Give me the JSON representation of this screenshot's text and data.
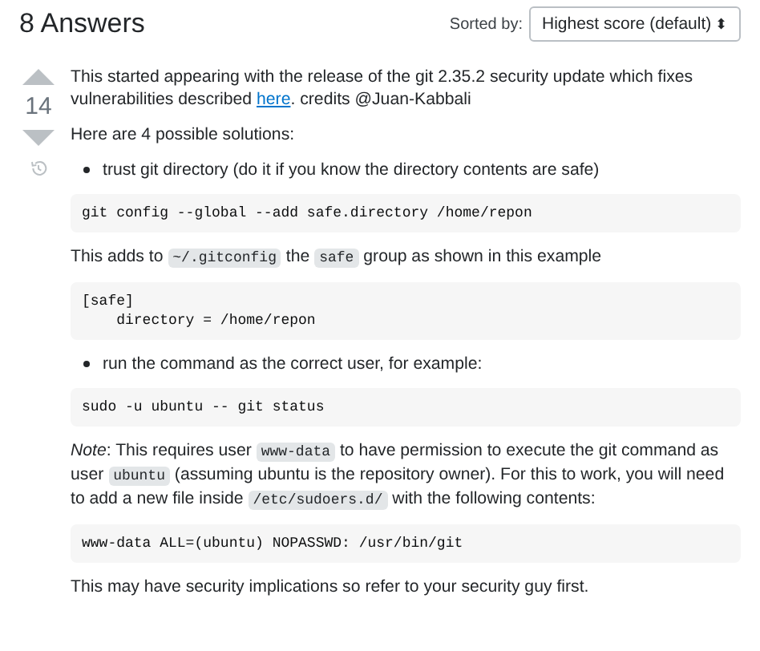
{
  "header": {
    "title": "8 Answers",
    "sort_label": "Sorted by:",
    "sort_value": "Highest score (default)",
    "sort_arrows": "⬍"
  },
  "answer": {
    "score": "14",
    "blocks": [
      {
        "kind": "paragraph",
        "parts": [
          {
            "text": "This started appearing with the release of the git 2.35.2 security update which fixes vulnerabilities described "
          },
          {
            "text": "here",
            "kind": "link"
          },
          {
            "text": ". credits @Juan-Kabbali"
          }
        ]
      },
      {
        "kind": "paragraph",
        "parts": [
          {
            "text": "Here are 4 possible solutions:"
          }
        ]
      },
      {
        "kind": "bullet",
        "text": "trust git directory (do it if you know the directory contents are safe)"
      },
      {
        "kind": "code",
        "lines": [
          "git config --global --add safe.directory /home/repon"
        ]
      },
      {
        "kind": "paragraph",
        "parts": [
          {
            "text": "This adds to "
          },
          {
            "text": "~/.gitconfig",
            "kind": "code"
          },
          {
            "text": " the "
          },
          {
            "text": "safe",
            "kind": "code"
          },
          {
            "text": " group as shown in this example"
          }
        ]
      },
      {
        "kind": "code",
        "lines": [
          "[safe]",
          "    directory = /home/repon"
        ]
      },
      {
        "kind": "bullet",
        "text": "run the command as the correct user, for example:"
      },
      {
        "kind": "code",
        "lines": [
          "sudo -u ubuntu -- git status"
        ]
      },
      {
        "kind": "paragraph",
        "parts": [
          {
            "text": "Note",
            "kind": "italic"
          },
          {
            "text": ": This requires user "
          },
          {
            "text": "www-data",
            "kind": "code"
          },
          {
            "text": " to have permission to execute the git command as user "
          },
          {
            "text": "ubuntu",
            "kind": "code"
          },
          {
            "text": " (assuming ubuntu is the repository owner). For this to work, you will need to add a new file inside "
          },
          {
            "text": "/etc/sudoers.d/",
            "kind": "code"
          },
          {
            "text": " with the following contents:"
          }
        ]
      },
      {
        "kind": "code",
        "lines": [
          "www-data ALL=(ubuntu) NOPASSWD: /usr/bin/git"
        ]
      },
      {
        "kind": "paragraph",
        "parts": [
          {
            "text": "This may have security implications so refer to your security guy first."
          }
        ]
      }
    ]
  }
}
